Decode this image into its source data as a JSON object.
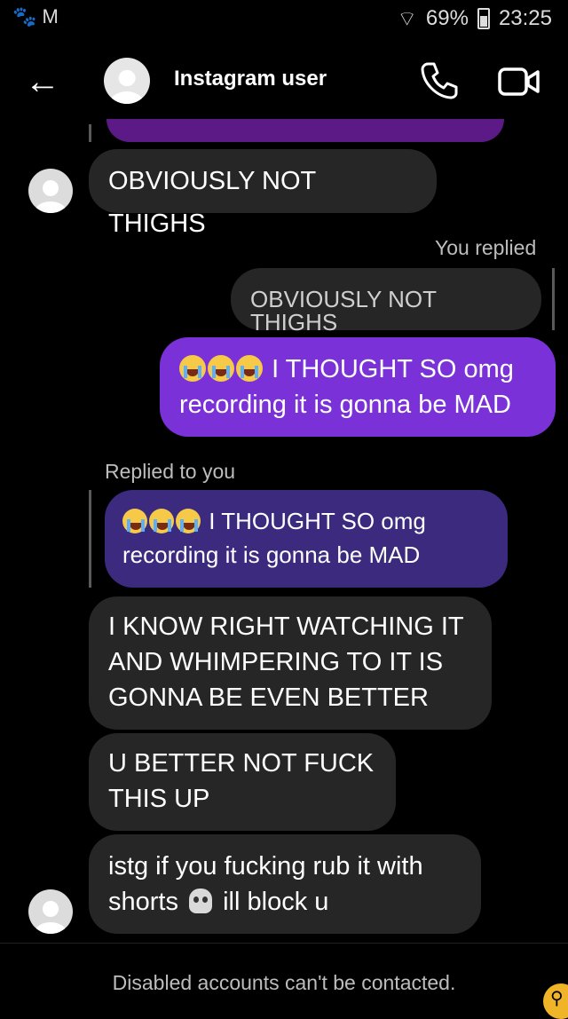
{
  "status_bar": {
    "left_icons": "🐾 M",
    "battery": "69%",
    "time": "23:25"
  },
  "header": {
    "title": "Instagram user"
  },
  "messages": {
    "m1": "OBVIOUSLY NOT THIGHS",
    "you_replied_label": "You replied",
    "reply_quote": "OBVIOUSLY NOT THIGHS",
    "out_line1": "I THOUGHT SO omg",
    "out_line2": "recording it is gonna be MAD",
    "replied_to_you_label": "Replied to you",
    "reply_in_line1": "I THOUGHT SO omg",
    "reply_in_line2": "recording it is gonna be MAD",
    "m2_l1": "I KNOW RIGHT WATCHING IT",
    "m2_l2": "AND WHIMPERING TO IT IS",
    "m2_l3": "GONNA BE EVEN BETTER",
    "m3_l1": "U BETTER NOT FUCK",
    "m3_l2": "THIS UP",
    "m4_l1": "istg if you fucking rub it with",
    "m4_l2a": "shorts",
    "m4_l2b": "ill block u"
  },
  "footer": {
    "text": "Disabled accounts can't be contacted."
  },
  "colors": {
    "outgoing": "#7a32d8",
    "incoming": "#262626",
    "reply_in": "#3b2a7e"
  }
}
